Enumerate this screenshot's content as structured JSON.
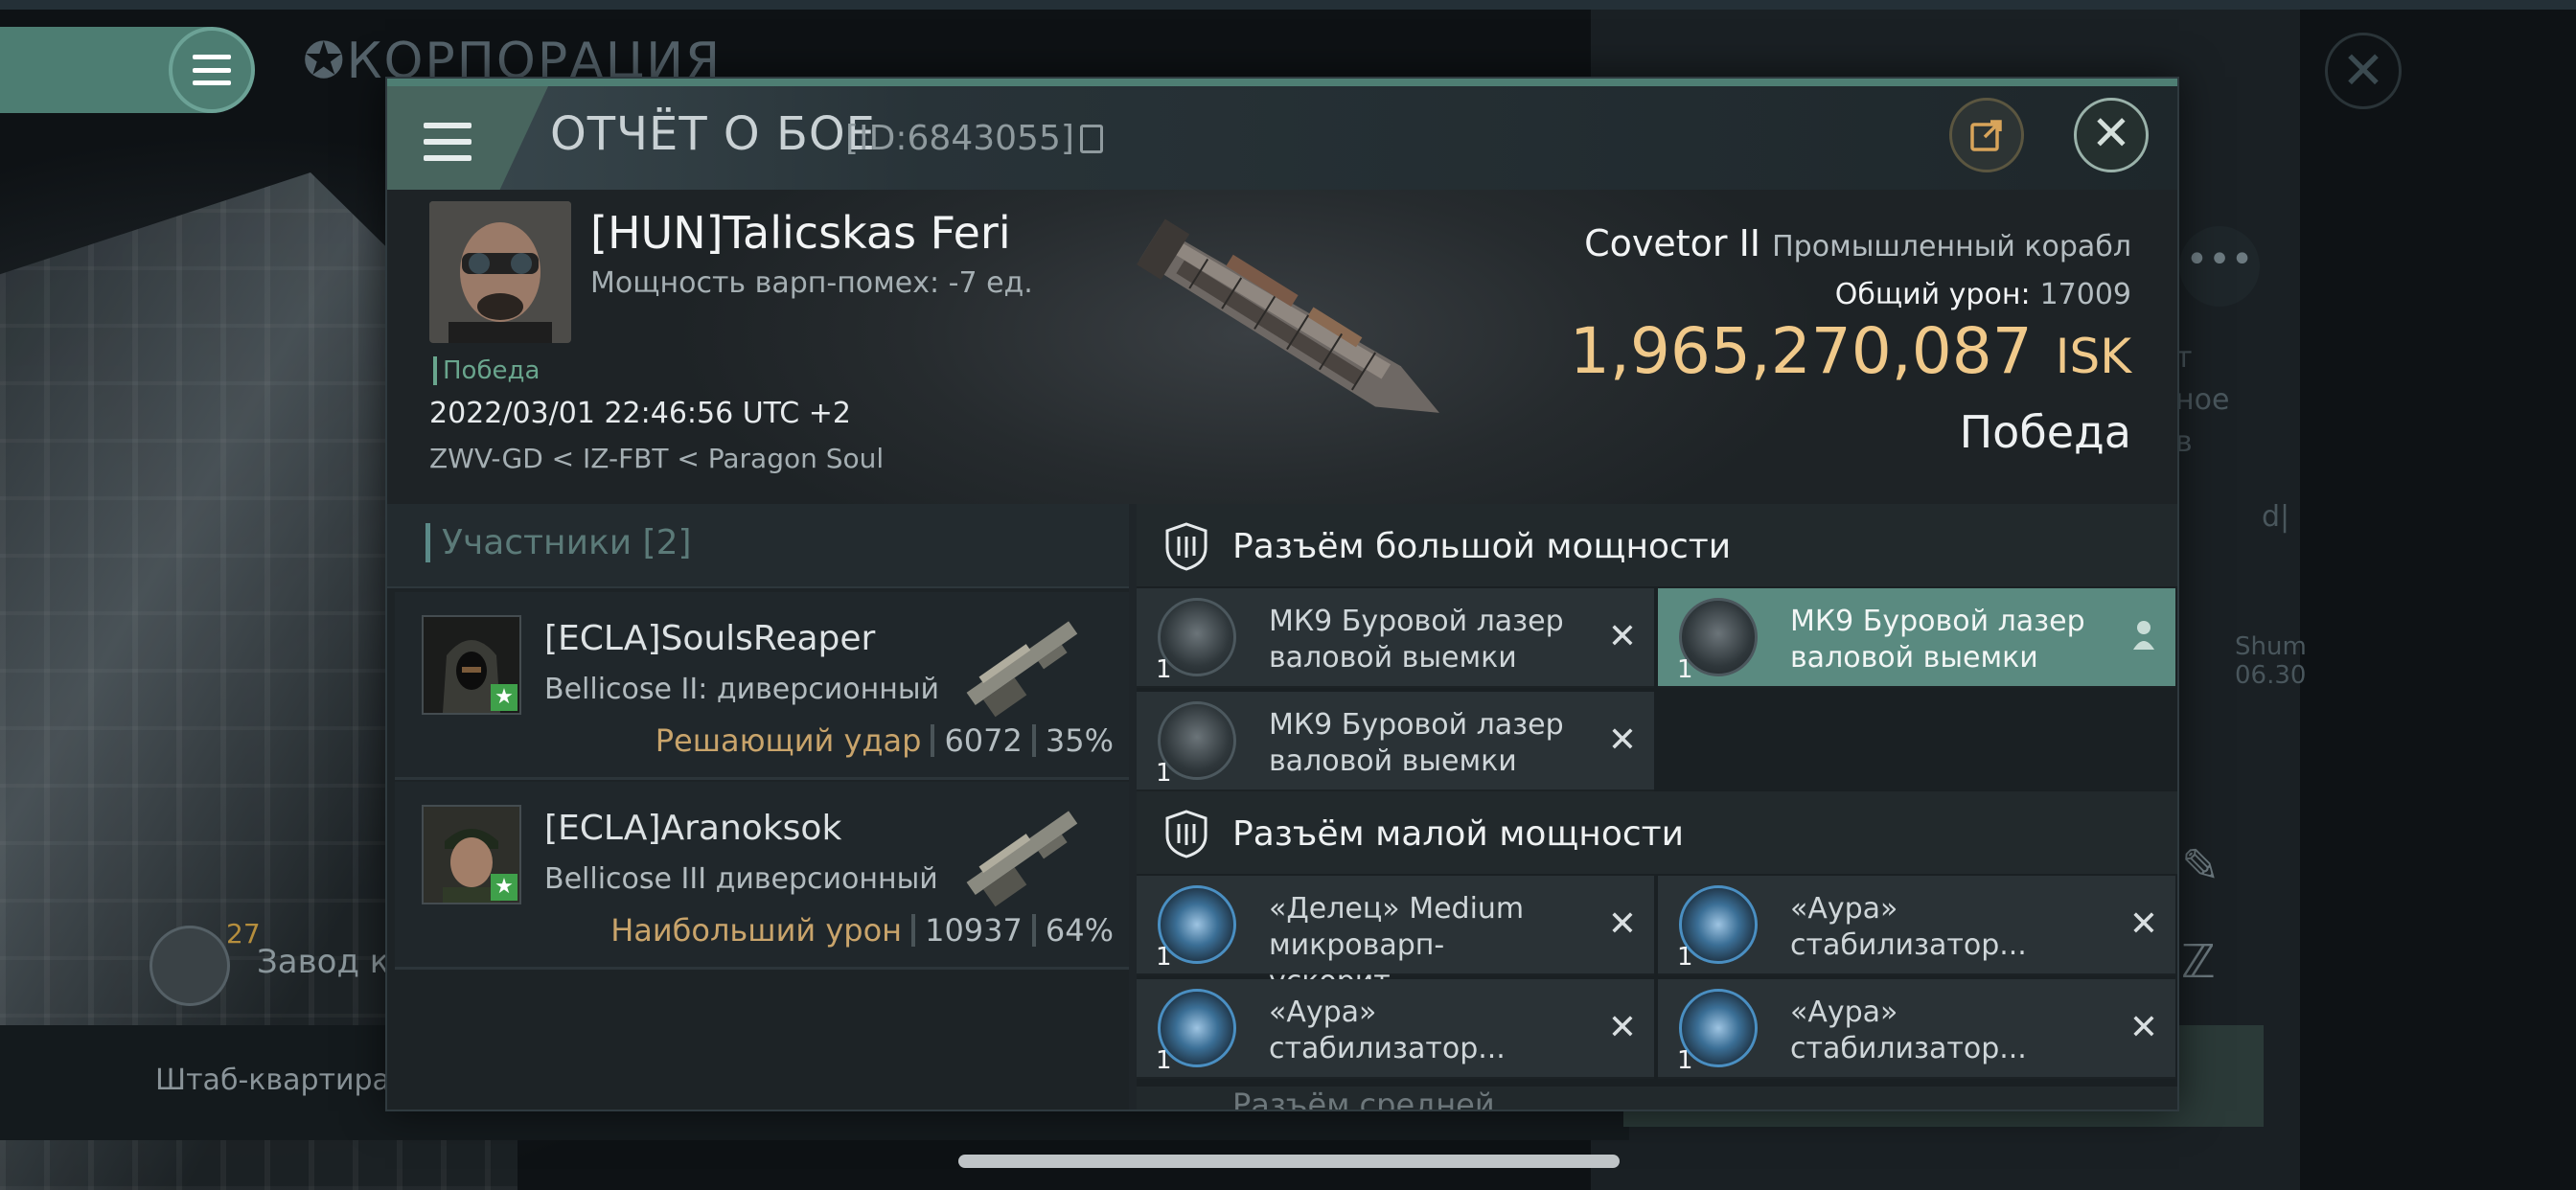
{
  "background": {
    "corp_title": "КОРПОРАЦИЯ",
    "side_text": [
      "т",
      "ное",
      "в",
      "d|",
      "Shum",
      "06.30"
    ],
    "factory_count": "27",
    "factory_label": "Завод к",
    "hq_label": "Штаб-квартира К"
  },
  "header": {
    "title": "ОТЧЁТ О БОЕ",
    "report_id": "[ID:6843055]"
  },
  "victim": {
    "name": "[HUN]Talicskas Feri",
    "warp_strength": "Мощность варп-помех: -7 ед.",
    "result_tag": "Победа",
    "date": "2022/03/01 22:46:56 UTC +2",
    "location": "ZWV-GD < IZ-FBT < Paragon Soul",
    "ship_name": "Covetor II",
    "ship_class": "Промышленный корабл",
    "total_damage_label": "Общий урон:",
    "total_damage": "17009",
    "isk_value": "1,965,270,087",
    "isk_unit": "ISK",
    "outcome": "Победа"
  },
  "participants": {
    "header": "Участники [2]",
    "list": [
      {
        "name": "[ECLA]SoulsReaper",
        "ship": "Bellicose II: диверсионный",
        "label": "Решающий удар",
        "damage": "6072",
        "percent": "35%"
      },
      {
        "name": "[ECLA]Aranoksok",
        "ship": "Bellicose III диверсионный",
        "label": "Наибольший урон",
        "damage": "10937",
        "percent": "64%"
      }
    ]
  },
  "fitting": {
    "high_slots_title": "Разъём большой мощности",
    "low_slots_title": "Разъём малой мощности",
    "next_section_partial": "Разъём средней",
    "high": [
      {
        "name": "МК9 Буровой лазер валовой выемки",
        "qty": "1",
        "state": "destroyed"
      },
      {
        "name": "МК9 Буровой лазер валовой выемки",
        "qty": "1",
        "state": "dropped"
      },
      {
        "name": "МК9 Буровой лазер валовой выемки",
        "qty": "1",
        "state": "destroyed"
      }
    ],
    "low": [
      {
        "name": "«Делец» Medium микроварп-ускорит....",
        "qty": "1",
        "state": "destroyed"
      },
      {
        "name": "«Аура» стабилизатор...",
        "qty": "1",
        "state": "destroyed"
      },
      {
        "name": "«Аура» стабилизатор...",
        "qty": "1",
        "state": "destroyed"
      },
      {
        "name": "«Аура» стабилизатор...",
        "qty": "1",
        "state": "destroyed"
      }
    ]
  },
  "colors": {
    "accent": "#4e7e73",
    "isk_gold": "#f0c98a",
    "victory_green": "#69a58d",
    "highlight_row": "#5a8a80"
  }
}
